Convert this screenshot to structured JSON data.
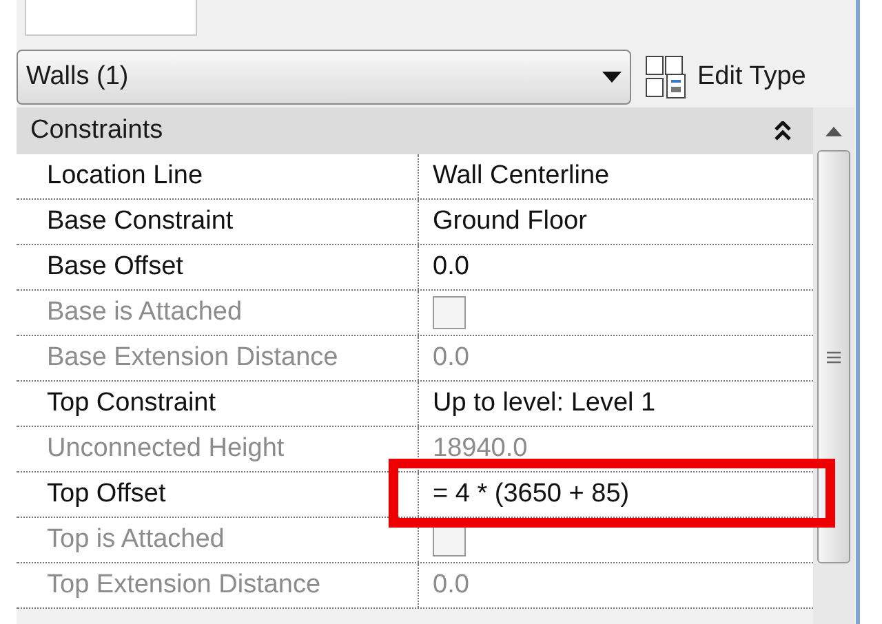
{
  "type_selector": {
    "value": "Walls (1)"
  },
  "edit_type_button": {
    "label": "Edit Type"
  },
  "group": {
    "title": "Constraints",
    "expanded": true
  },
  "properties": [
    {
      "label": "Location Line",
      "kind": "text",
      "value": "Wall Centerline",
      "disabled": false
    },
    {
      "label": "Base Constraint",
      "kind": "text",
      "value": "Ground Floor",
      "disabled": false
    },
    {
      "label": "Base Offset",
      "kind": "text",
      "value": "0.0",
      "disabled": false
    },
    {
      "label": "Base is Attached",
      "kind": "checkbox",
      "checked": false,
      "disabled": true
    },
    {
      "label": "Base Extension Distance",
      "kind": "text",
      "value": "0.0",
      "disabled": true
    },
    {
      "label": "Top Constraint",
      "kind": "text",
      "value": "Up to level: Level 1",
      "disabled": false
    },
    {
      "label": "Unconnected Height",
      "kind": "text",
      "value": "18940.0",
      "disabled": true
    },
    {
      "label": "Top Offset",
      "kind": "text",
      "value": "= 4 * (3650 + 85)",
      "disabled": false,
      "highlighted": true
    },
    {
      "label": "Top is Attached",
      "kind": "checkbox",
      "checked": false,
      "disabled": true
    },
    {
      "label": "Top Extension Distance",
      "kind": "text",
      "value": "0.0",
      "disabled": true
    }
  ]
}
